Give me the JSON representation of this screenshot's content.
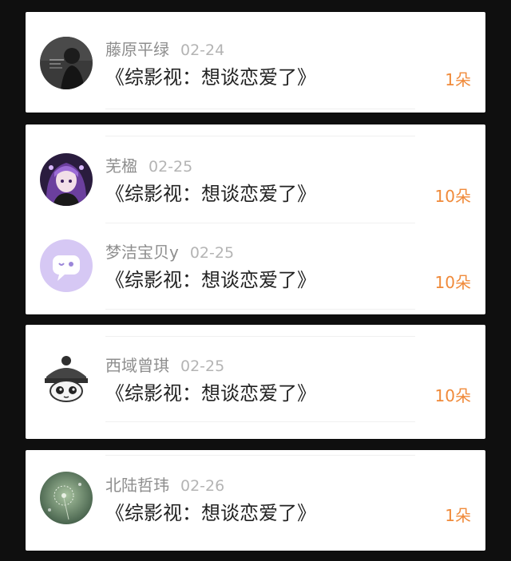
{
  "colors": {
    "background": "#0f0f0f",
    "card": "#ffffff",
    "name": "#8e8e8e",
    "date": "#b4b4b4",
    "title": "#222222",
    "amount": "#f08a3a"
  },
  "cards": [
    {
      "entries": [
        {
          "name": "藤原平绿",
          "date": "02-24",
          "title": "《综影视：想谈恋爱了》",
          "amount": "1朵",
          "avatar": "dark-figure-avatar"
        }
      ]
    },
    {
      "entries": [
        {
          "name": "芜楹",
          "date": "02-25",
          "title": "《综影视：想谈恋爱了》",
          "amount": "10朵",
          "avatar": "anime-girl-avatar"
        },
        {
          "name": "梦洁宝贝y",
          "date": "02-25",
          "title": "《综影视：想谈恋爱了》",
          "amount": "10朵",
          "avatar": "default-chat-avatar"
        }
      ]
    },
    {
      "entries": [
        {
          "name": "西域曾琪",
          "date": "02-25",
          "title": "《综影视：想谈恋爱了》",
          "amount": "10朵",
          "avatar": "cartoon-character-avatar"
        }
      ]
    },
    {
      "entries": [
        {
          "name": "北陆哲玮",
          "date": "02-26",
          "title": "《综影视：想谈恋爱了》",
          "amount": "1朵",
          "avatar": "dandelion-avatar"
        }
      ]
    }
  ]
}
